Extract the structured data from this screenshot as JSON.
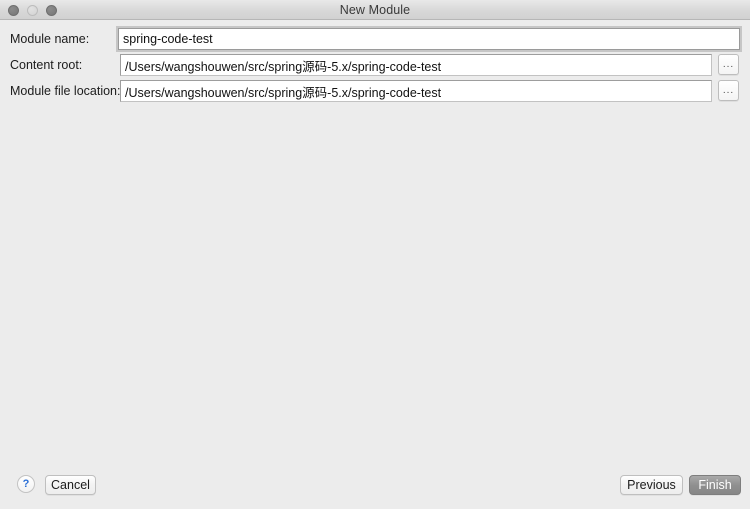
{
  "window": {
    "title": "New Module",
    "traffic_lights": [
      {
        "name": "close",
        "color": "#7d7d7d"
      },
      {
        "name": "minimize",
        "color": "#d8d8d8"
      },
      {
        "name": "zoom",
        "color": "#7d7d7d"
      }
    ],
    "background_color": "#ececec"
  },
  "form": {
    "rows": [
      {
        "label": "Module name:",
        "value": "spring-code-test",
        "focused": true,
        "has_browse": false
      },
      {
        "label": "Content root:",
        "value": "/Users/wangshouwen/src/spring源码-5.x/spring-code-test",
        "focused": false,
        "has_browse": true,
        "browse_label": "..."
      },
      {
        "label": "Module file location:",
        "value": "/Users/wangshouwen/src/spring源码-5.x/spring-code-test",
        "focused": false,
        "has_browse": true,
        "browse_label": "..."
      }
    ]
  },
  "footer": {
    "help_label": "?",
    "cancel_label": "Cancel",
    "previous_label": "Previous",
    "finish_label": "Finish",
    "finish_accent_color": "#909090",
    "help_accent_color": "#2a6fd6"
  }
}
